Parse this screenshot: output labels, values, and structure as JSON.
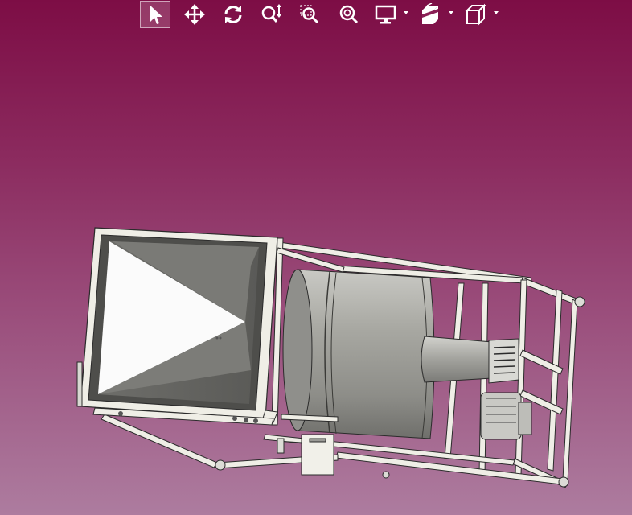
{
  "viewer": {
    "background_top": "#7d0d45",
    "background_bottom": "#ad7c9f",
    "model_color": "#9a9a96",
    "frame_color": "#efeee6",
    "active_tool": "select"
  },
  "toolbar": {
    "buttons": [
      {
        "name": "select-button",
        "icon": "arrow-cursor-icon",
        "has_menu": false
      },
      {
        "name": "pan-button",
        "icon": "move-arrows-icon",
        "has_menu": false
      },
      {
        "name": "rotate-button",
        "icon": "rotate-icon",
        "has_menu": false
      },
      {
        "name": "zoom-button",
        "icon": "zoom-icon",
        "has_menu": false
      },
      {
        "name": "zoom-window-button",
        "icon": "zoom-window-icon",
        "has_menu": false
      },
      {
        "name": "zoom-fit-button",
        "icon": "zoom-fit-icon",
        "has_menu": false
      },
      {
        "name": "display-mode-button",
        "icon": "monitor-icon",
        "has_menu": true
      },
      {
        "name": "section-view-button",
        "icon": "section-cube-icon",
        "has_menu": true
      },
      {
        "name": "standard-views-button",
        "icon": "cube-icon",
        "has_menu": true
      }
    ]
  }
}
